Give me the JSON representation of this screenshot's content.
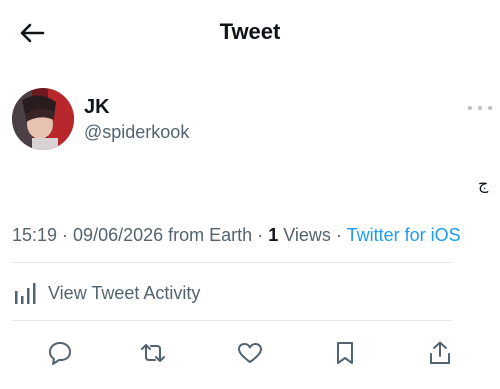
{
  "header": {
    "title": "Tweet",
    "back_icon": "arrow-left-icon"
  },
  "tweet": {
    "author": {
      "name": "JK",
      "handle": "@spiderkook"
    },
    "glyph": "ج",
    "time": "15:19",
    "date": "09/06/2026",
    "location": "from Earth",
    "views_count": "1",
    "views_label": "Views",
    "source": "Twitter for iOS"
  },
  "activity": {
    "label": "View Tweet Activity",
    "icon": "bar-chart-icon"
  },
  "actions": [
    {
      "name": "reply",
      "icon": "reply-icon"
    },
    {
      "name": "retweet",
      "icon": "retweet-icon"
    },
    {
      "name": "like",
      "icon": "heart-icon"
    },
    {
      "name": "bookmark",
      "icon": "bookmark-icon"
    },
    {
      "name": "share",
      "icon": "share-icon"
    }
  ],
  "colors": {
    "link": "#1d9bf0",
    "muted": "#536471",
    "text": "#0f1419"
  }
}
